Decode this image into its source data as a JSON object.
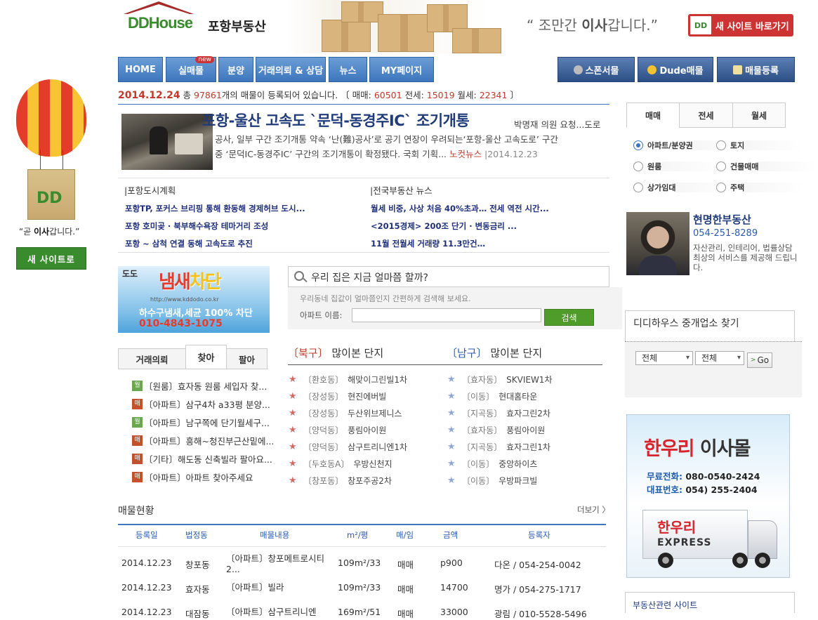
{
  "header": {
    "brand": "DDHouse",
    "city": "포항부동산",
    "slogan_pre": "“ 조만간 ",
    "slogan_bold": "이사",
    "slogan_post": "갑니다.”",
    "new_site_button": "새 사이트 바로가기",
    "dd_logo": "DD"
  },
  "nav": {
    "items": [
      {
        "label": "HOME"
      },
      {
        "label": "실매물",
        "badge": "new"
      },
      {
        "label": "분양"
      },
      {
        "label": "거래의뢰 & 상담"
      },
      {
        "label": "뉴스"
      },
      {
        "label": "MY페이지"
      }
    ],
    "right": [
      {
        "label": "스폰서물",
        "icon": "medal-silver-icon",
        "color": "#b8b8b8"
      },
      {
        "label": "Dude매물",
        "icon": "medal-gold-icon",
        "color": "#f2c230"
      },
      {
        "label": "매물등록",
        "icon": "pencil-icon",
        "color": "#f0e0a0"
      }
    ]
  },
  "stats": {
    "date": "2014.12.24",
    "pre_total": " 총 ",
    "total": "97861",
    "post_total": "개의 매물이 등록되어 있습니다.  〔 매매: ",
    "sale": "60501",
    "jeonse_label": "   전세: ",
    "jeonse": "15019",
    "monthly_label": "   월세: ",
    "monthly": "22341",
    "close": " 〕"
  },
  "headline": {
    "title": "포항-울산 고속도 `문덕-동경주IC` 조기개통",
    "sub": "박명재 의원 요청...도로",
    "line1": "공사, 일부 구간 조기개통 약속          ‘난(難)공사’로 공기 연장이 우려되는‘포항-울산 고속도로’ 구간",
    "line2": "중 ‘문덕IC-동경주IC’ 구간의 조기개통이 확정됐다.   국회 기획...",
    "source": "노컷뉴스",
    "date": " |2014.12.23"
  },
  "news": {
    "left_title": "|포항도시계획",
    "right_title": "|전국부동산 뉴스",
    "left": [
      "포항TP, 포커스 브리핑 통해 환동해 경제허브 도시...",
      "포항 호미곶 · 북부해수욕장 테마거리 조성",
      "포항 ~ 삼척 연결 동해 고속도로 추진"
    ],
    "right": [
      "월세 비중, 사상 처음 40%초과… 전세 역전 시간...",
      "<2015경제> 200조 단기 · 변동금리 ...",
      "11월 전월세 거래량 11.3만건…"
    ]
  },
  "ad_left": {
    "t1": "도도",
    "t2a": "냄새",
    "t2b": "차단",
    "url": "http://www.kddodo.co.kr",
    "t3": "하수구냄새,세균 100% 차단",
    "t4": "010-4843-1075"
  },
  "search": {
    "title": "우리 집은 지금 얼마쯤 할까?",
    "help": "우리동네 집값이 얼마쯤인지 간편하게 검색해 보세요.",
    "label": "아파트 이름:",
    "value": "",
    "button": "검색"
  },
  "trade_tabs": {
    "tabs": [
      "거래의뢰",
      "찾아",
      "팔아"
    ],
    "active": 1,
    "items": [
      {
        "tag": "월",
        "tag_color": "#6aa84f",
        "text": "〔원룸〕효자동 원룸 세입자 찾..."
      },
      {
        "tag": "매",
        "tag_color": "#c0522d",
        "text": "〔아파트〕삼구4차 a33평 분양..."
      },
      {
        "tag": "월",
        "tag_color": "#6aa84f",
        "text": "〔아파트〕남구쪽에 단기월세구..."
      },
      {
        "tag": "매",
        "tag_color": "#c0522d",
        "text": "〔아파트〕흥해~청진부근산밑에..."
      },
      {
        "tag": "매",
        "tag_color": "#c0522d",
        "text": "〔기타〕해도동 신축빌라 팔아요..."
      },
      {
        "tag": "매",
        "tag_color": "#c0522d",
        "text": "〔아파트〕아파트 찾아주세요"
      }
    ]
  },
  "complexes": {
    "north_key": "〔북구〕",
    "north_title": " 많이본 단지",
    "south_key": "〔남구〕",
    "south_title": " 많이본 단지",
    "north": [
      {
        "dong": "〔환호동〕",
        "name": "해맞이그린빌1차"
      },
      {
        "dong": "〔장성동〕",
        "name": "현진에버빌"
      },
      {
        "dong": "〔장성동〕",
        "name": "두산위브제니스"
      },
      {
        "dong": "〔양덕동〕",
        "name": "풍림아이원"
      },
      {
        "dong": "〔양덕동〕",
        "name": "삼구트리니엔1차"
      },
      {
        "dong": "〔두호동A〕",
        "name": "우방신천지"
      },
      {
        "dong": "〔창포동〕",
        "name": "창포주공2차"
      }
    ],
    "south": [
      {
        "dong": "〔효자동〕",
        "name": "SKVIEW1차"
      },
      {
        "dong": "〔이동〕",
        "name": "현대홈타운"
      },
      {
        "dong": "〔지곡동〕",
        "name": "효자그린2차"
      },
      {
        "dong": "〔효자동〕",
        "name": "풍림아이원"
      },
      {
        "dong": "〔지곡동〕",
        "name": "효자그린1차"
      },
      {
        "dong": "〔이동〕",
        "name": "중앙하이츠"
      },
      {
        "dong": "〔이동〕",
        "name": "우방파크빌"
      }
    ]
  },
  "listing": {
    "title": "매물현황",
    "more": "더보기 〉",
    "headers": [
      "등록일",
      "법정동",
      "매물내용",
      "m²/평",
      "매/임",
      "금액",
      "등록자"
    ],
    "rows": [
      [
        "2014.12.23",
        "창포동",
        "〔아파트〕창포메트로시티 2...",
        "109m²/33",
        "매매",
        "p900",
        "다온 / 054-254-0042"
      ],
      [
        "2014.12.23",
        "효자동",
        "〔아파트〕빌라",
        "109m²/33",
        "매매",
        "14700",
        "명가 / 054-275-1717"
      ],
      [
        "2014.12.23",
        "대잠동",
        "〔아파트〕삼구트리니엔",
        "169m²/51",
        "매매",
        "33000",
        "광림 / 010-5528-5496"
      ]
    ]
  },
  "right": {
    "tabs": [
      "매매",
      "전세",
      "월세"
    ],
    "active": 0,
    "types": [
      {
        "label": "아파트/분양권",
        "checked": true
      },
      {
        "label": "토지",
        "checked": false
      },
      {
        "label": "원룸",
        "checked": false
      },
      {
        "label": "건물매매",
        "checked": false
      },
      {
        "label": "상가임대",
        "checked": false
      },
      {
        "label": "주택",
        "checked": false
      }
    ],
    "agent": {
      "name": "현명한부동산",
      "tel": "054-251-8289",
      "desc": "자산관리, 인테리어, 법률상담 최상의 서비스를 제공해 드립니다."
    },
    "find_title": "디디하우스 중개업소 찾기",
    "select1": "전체",
    "select2": "전체",
    "go": "Go",
    "moving_ad": {
      "brand": "한우리",
      "brand2": " 이사몰",
      "free_label": "무료전화:",
      "free": " 080-0540-2424",
      "rep_label": "대표번호:",
      "rep": " 054) 255-2404",
      "truck1": "한우리",
      "truck2": "EXPRESS"
    },
    "related": "부동산관련 사이트"
  },
  "left_float": {
    "caption_pre": "“곧 ",
    "caption_bold": "이사",
    "caption_post": "갑니다.”",
    "button": "새 사이트로",
    "logo": "DD"
  },
  "colors": {
    "nav_blue": "#3e76bd",
    "accent_red": "#c0392b",
    "brand_green": "#3a8a2e"
  }
}
